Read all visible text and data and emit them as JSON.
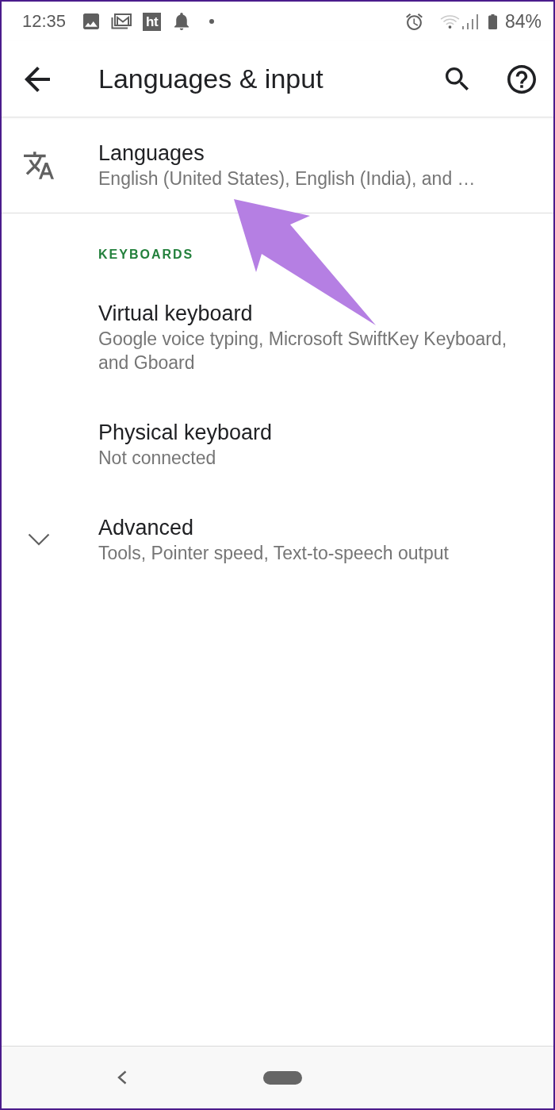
{
  "status_bar": {
    "time": "12:35",
    "app_badge": "ht",
    "battery": "84%"
  },
  "app_bar": {
    "title": "Languages & input"
  },
  "languages": {
    "title": "Languages",
    "summary": "English (United States), English (India), and …"
  },
  "sections": [
    {
      "header": "KEYBOARDS",
      "items": [
        {
          "title": "Virtual keyboard",
          "summary": "Google voice typing, Microsoft SwiftKey Keyboard, and Gboard"
        },
        {
          "title": "Physical keyboard",
          "summary": "Not connected"
        }
      ]
    }
  ],
  "advanced": {
    "title": "Advanced",
    "summary": "Tools, Pointer speed, Text-to-speech output",
    "expanded": false
  }
}
